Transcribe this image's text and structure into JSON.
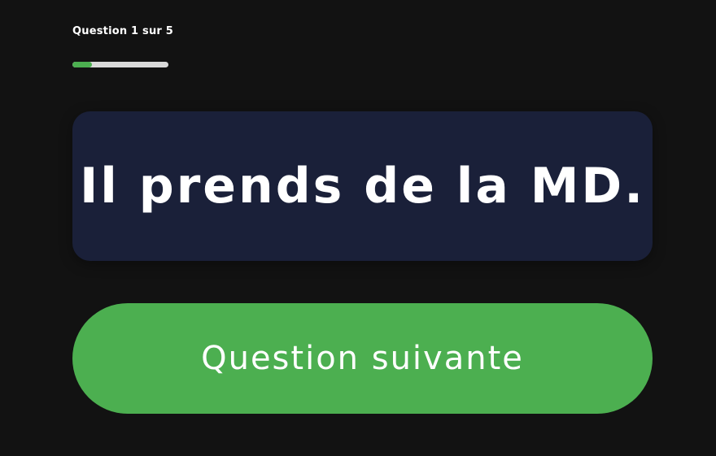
{
  "progress": {
    "label": "Question 1 sur 5",
    "current": 1,
    "total": 5,
    "fraction": 0.2,
    "fill_color": "#4caf50",
    "track_color": "#d9d9d9"
  },
  "question": {
    "text": "Il prends de la MD."
  },
  "next_button": {
    "label": "Question suivante",
    "color": "#4caf50"
  },
  "theme": {
    "background": "#121212",
    "card_color": "#1a2039",
    "text_color": "#ffffff"
  }
}
